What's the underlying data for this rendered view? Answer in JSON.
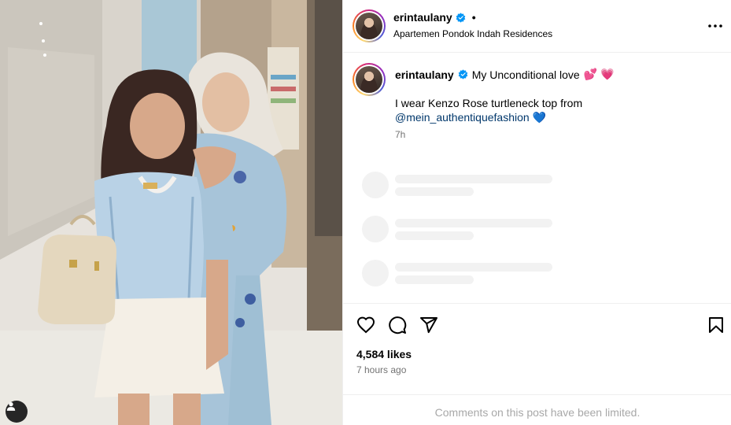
{
  "post": {
    "username": "erintaulany",
    "separator": "•",
    "location": "Apartemen Pondok Indah Residences",
    "caption_lead": "My Unconditional love",
    "caption_emoji": "💕 💗",
    "caption_body": "I wear Kenzo Rose turtleneck top from",
    "mention": "@mein_authentiquefashion",
    "mention_emoji": "💙",
    "caption_time": "7h",
    "likes": "4,584 likes",
    "posted_ago": "7 hours ago",
    "comments_limited": "Comments on this post have been limited."
  },
  "icons": {
    "verified": "verified-badge-icon",
    "more": "more-options-icon",
    "like": "heart-icon",
    "comment": "comment-bubble-icon",
    "share": "paper-plane-icon",
    "save": "bookmark-icon",
    "tag": "user-tag-icon"
  },
  "colors": {
    "verified_blue": "#0095f6",
    "mention_blue": "#00376b",
    "muted_text": "#737373",
    "limited_text": "#a8a8a8"
  }
}
